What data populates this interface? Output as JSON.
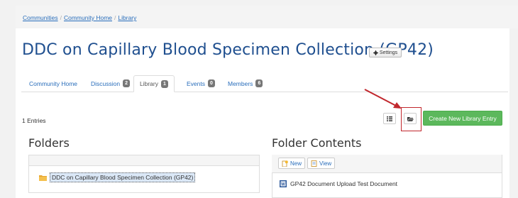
{
  "breadcrumb": {
    "items": [
      "Communities",
      "Community Home",
      "Library"
    ],
    "separator": "/"
  },
  "page": {
    "title": "DDC on Capillary Blood Specimen Collection (GP42)",
    "settings_label": "Settings"
  },
  "tabs": [
    {
      "label": "Community Home",
      "badge": ""
    },
    {
      "label": "Discussion",
      "badge": "2"
    },
    {
      "label": "Library",
      "badge": "1",
      "active": true
    },
    {
      "label": "Events",
      "badge": "0"
    },
    {
      "label": "Members",
      "badge": "6"
    }
  ],
  "toolbar": {
    "entries_text": "1 Entries",
    "list_view_icon": "list-icon",
    "folder_view_icon": "folder-open-icon",
    "create_label": "Create New Library Entry"
  },
  "folders": {
    "heading": "Folders",
    "items": [
      {
        "label": "DDC on Capillary Blood Specimen Collection (GP42)",
        "icon": "folder-icon"
      }
    ]
  },
  "contents": {
    "heading": "Folder Contents",
    "new_label": "New",
    "view_label": "View",
    "documents": [
      {
        "label": "GP42 Document Upload Test Document",
        "icon": "word-doc-icon"
      }
    ]
  },
  "colors": {
    "link": "#2a6ebb",
    "title": "#1f4f8f",
    "create_button": "#5cb85c",
    "highlight": "#c1272d",
    "badge": "#777777"
  }
}
